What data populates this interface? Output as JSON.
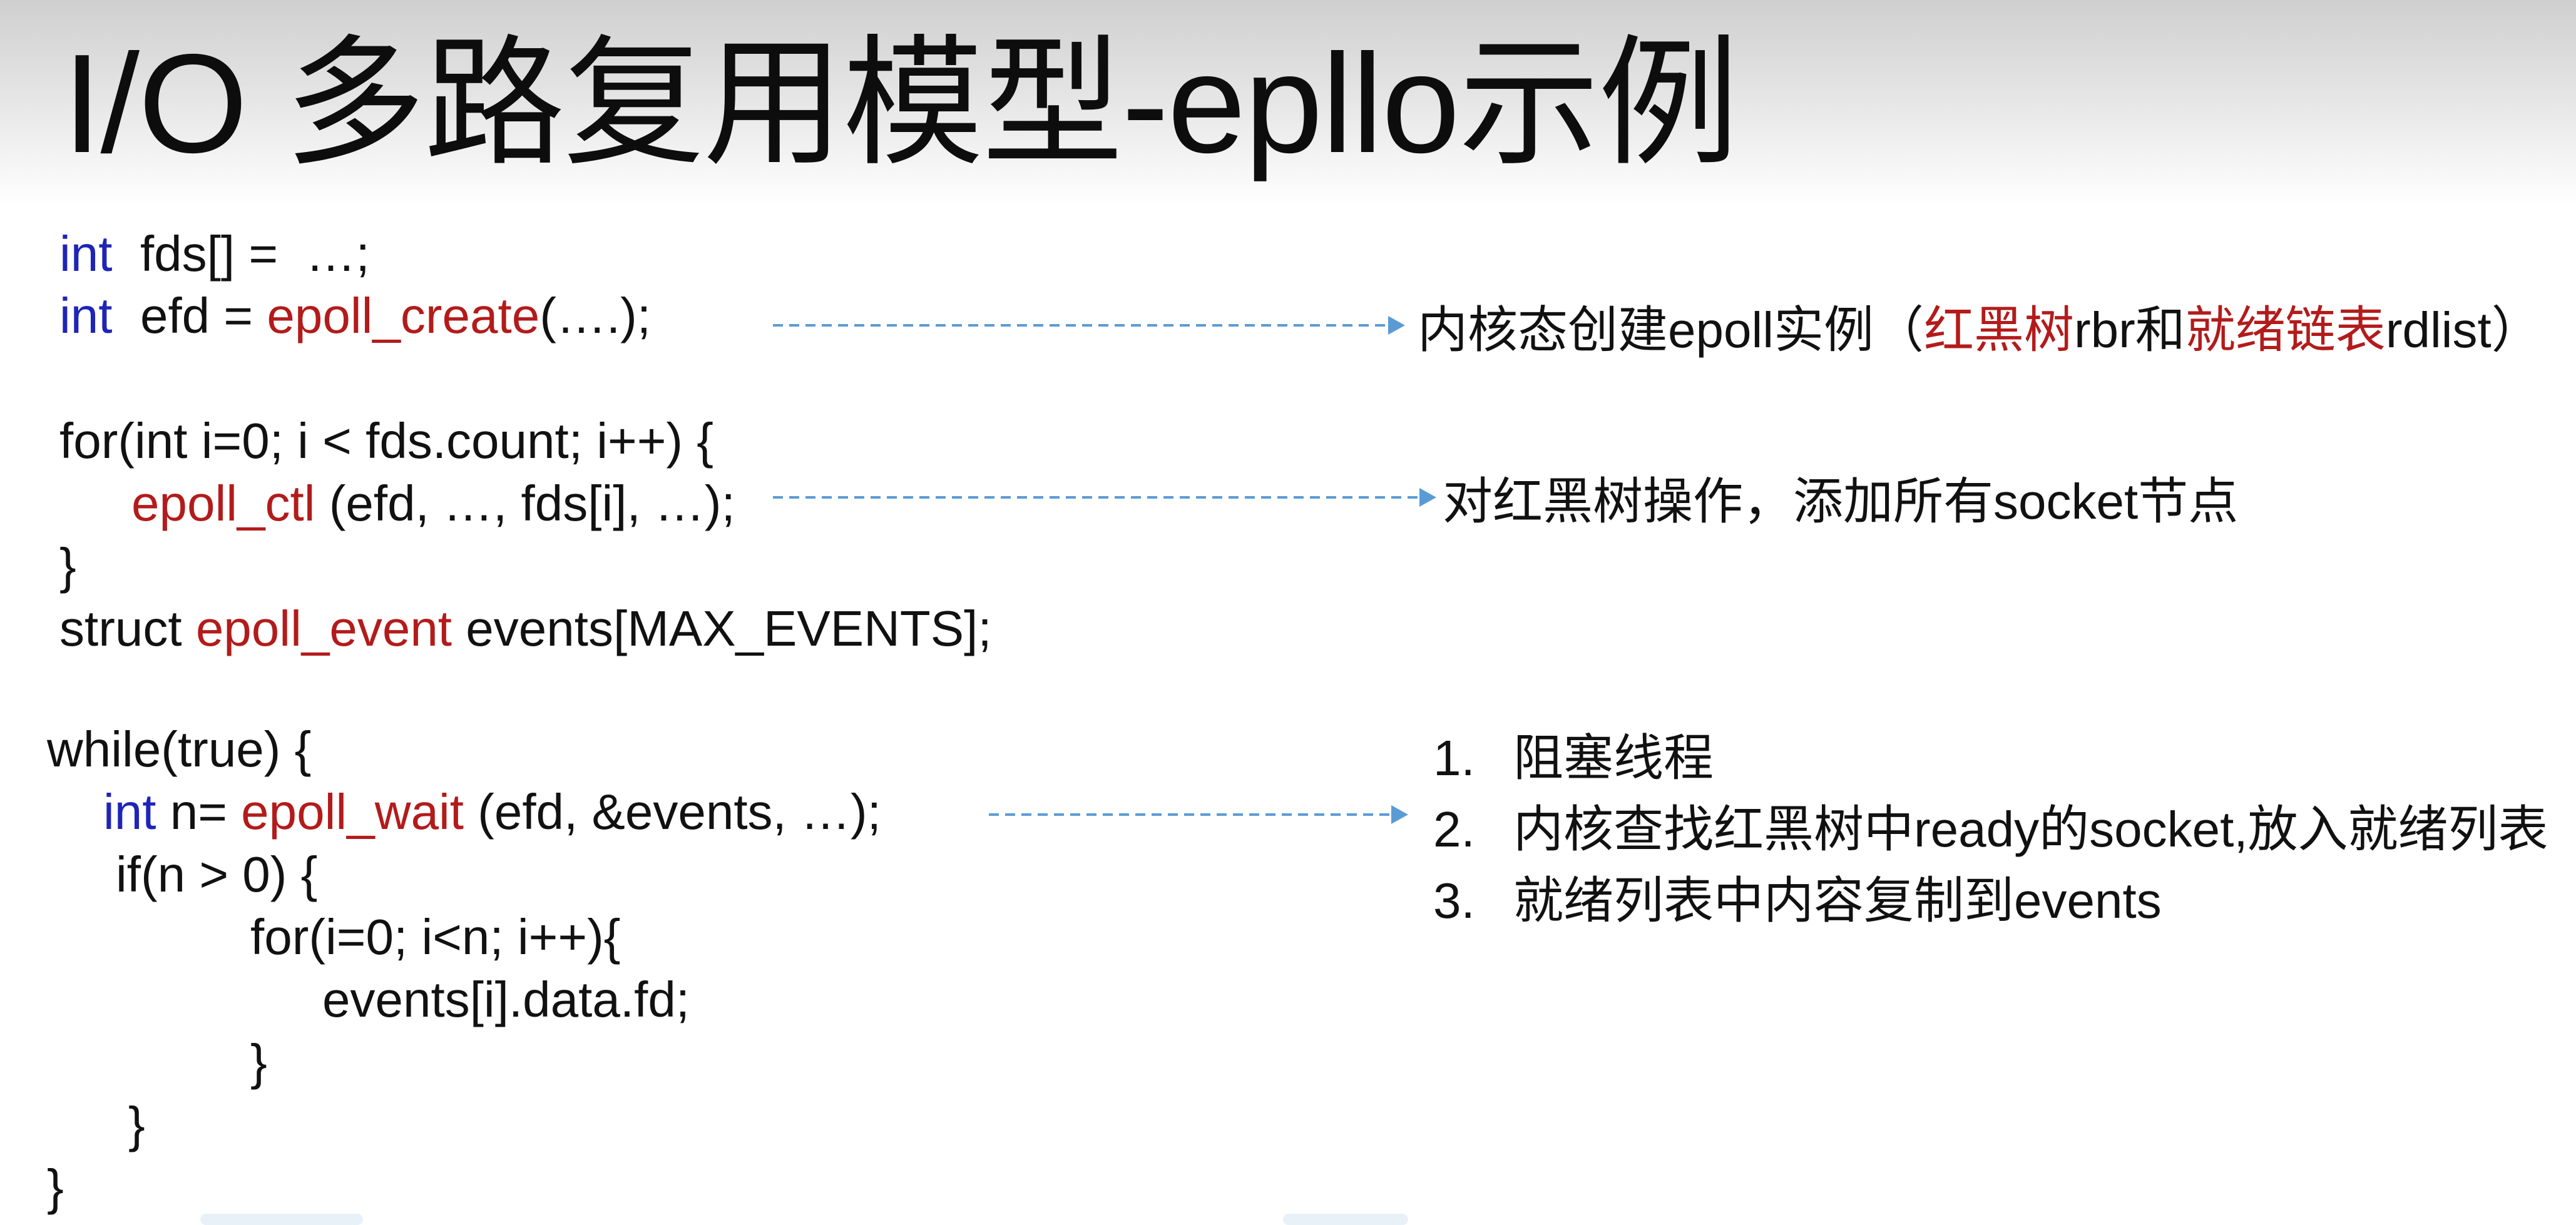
{
  "title": "I/O 多路复用模型-epllo示例",
  "code": {
    "l1": {
      "kw": "int",
      "rest": "  fds[] =  …;"
    },
    "l2": {
      "kw": "int",
      "mid": "  efd = ",
      "fn": "epoll_create",
      "rest": "(….);"
    },
    "l3": {
      "text": "for(int i=0; i < fds.count; i++) {"
    },
    "l4": {
      "fn": "epoll_ctl",
      "rest": " (efd, …, fds[i], …);"
    },
    "l5": {
      "text": "}"
    },
    "l6": {
      "pre": "struct ",
      "fn": "epoll_event",
      "rest": " events[MAX_EVENTS];"
    },
    "l7": {
      "text": "while(true) {"
    },
    "l8": {
      "kw": "int",
      "mid": " n= ",
      "fn": "epoll_wait",
      "rest": " (efd, &events, …);"
    },
    "l9": {
      "text": "if(n > 0) {"
    },
    "l10": {
      "text": "for(i=0; i<n; i++){"
    },
    "l11": {
      "text": "events[i].data.fd;"
    },
    "l12": {
      "text": "}"
    },
    "l13": {
      "text": "}"
    },
    "l14": {
      "text": "}"
    }
  },
  "notes": {
    "create": {
      "t1": "内核态创建epoll实例（",
      "r1": "红黑树",
      "t2": "rbr和",
      "r2": "就绪链表",
      "t3": "rdlist）"
    },
    "ctl": "对红黑树操作，添加所有socket节点",
    "wait_list": [
      {
        "num": "1.",
        "text": "阻塞线程"
      },
      {
        "num": "2.",
        "text": "内核查找红黑树中ready的socket,放入就绪列表"
      },
      {
        "num": "3.",
        "text": "就绪列表中内容复制到events"
      }
    ]
  },
  "colors": {
    "keyword": "#1f24b8",
    "function": "#b31b1b",
    "arrow": "#5b9bd5"
  }
}
